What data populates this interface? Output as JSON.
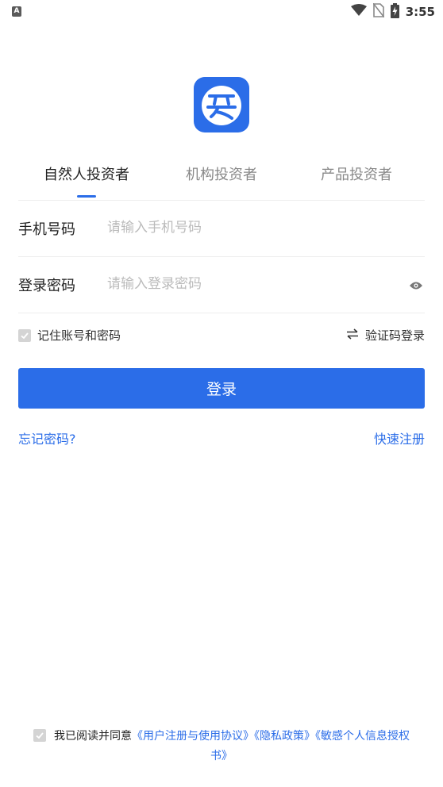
{
  "status_bar": {
    "app_icon_letter": "A",
    "time": "3:55"
  },
  "tabs": [
    {
      "label": "自然人投资者",
      "active": true
    },
    {
      "label": "机构投资者",
      "active": false
    },
    {
      "label": "产品投资者",
      "active": false
    }
  ],
  "phone": {
    "label": "手机号码",
    "placeholder": "请输入手机号码",
    "value": ""
  },
  "password": {
    "label": "登录密码",
    "placeholder": "请输入登录密码",
    "value": ""
  },
  "options": {
    "remember_label": "记住账号和密码",
    "remember_checked": true,
    "sms_login_label": "验证码登录"
  },
  "login_button_label": "登录",
  "forgot_password_label": "忘记密码?",
  "register_label": "快速注册",
  "agreement": {
    "prefix": "我已阅读并同意",
    "link_user_agreement": "《用户注册与使用协议》",
    "link_privacy": "《隐私政策》",
    "link_sensitive": "《敏感个人信息授权书》",
    "checked": true
  },
  "colors": {
    "accent": "#2b6de8",
    "checkbox_gray": "#d4d4d4",
    "placeholder": "#bbbbbb",
    "divider": "#eeeeee"
  }
}
